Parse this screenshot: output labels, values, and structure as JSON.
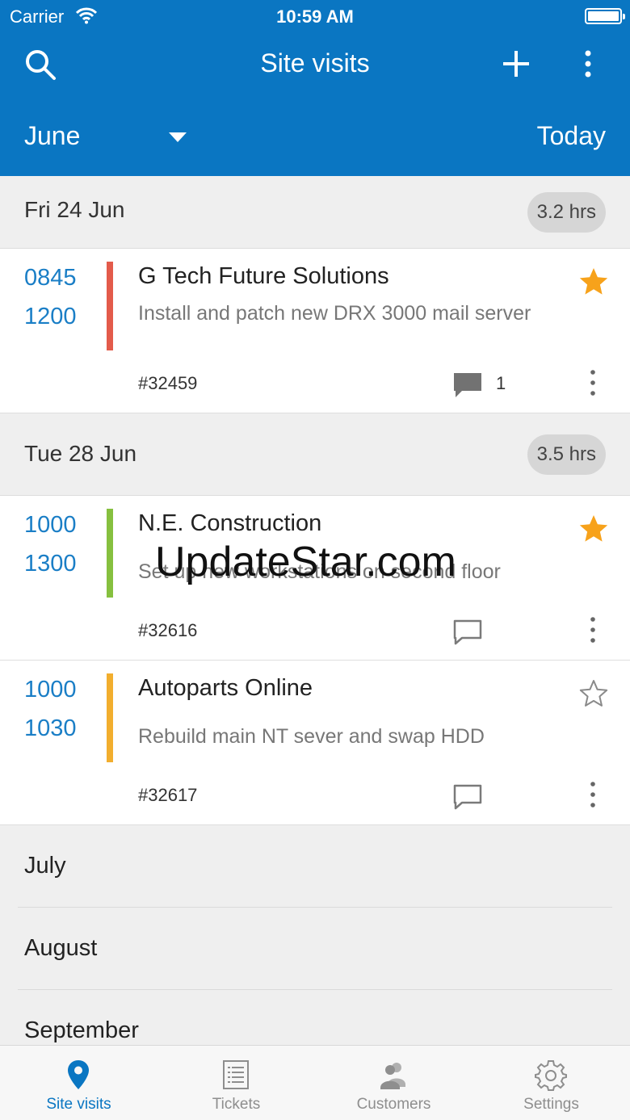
{
  "status_bar": {
    "carrier": "Carrier",
    "time": "10:59 AM"
  },
  "header": {
    "title": "Site visits",
    "month": "June",
    "today_label": "Today",
    "background_color": "#0a76c2"
  },
  "groups": [
    {
      "date": "Fri 24 Jun",
      "hours": "3.2 hrs",
      "visits": [
        {
          "start": "0845",
          "end": "1200",
          "customer": "G Tech Future Solutions",
          "description": "Install and patch new DRX 3000 mail server",
          "ticket": "#32459",
          "comment_count": "1",
          "starred": true,
          "bar_color": "#e35b4b"
        }
      ]
    },
    {
      "date": "Tue 28 Jun",
      "hours": "3.5 hrs",
      "visits": [
        {
          "start": "1000",
          "end": "1300",
          "customer": "N.E. Construction",
          "description": "Set up new workstations on second floor",
          "ticket": "#32616",
          "comment_count": "",
          "starred": true,
          "bar_color": "#86c03f"
        },
        {
          "start": "1000",
          "end": "1030",
          "customer": "Autoparts Online",
          "description": "Rebuild main NT sever and swap HDD",
          "ticket": "#32617",
          "comment_count": "",
          "starred": false,
          "bar_color": "#f2ae2e"
        }
      ]
    }
  ],
  "months": [
    "July",
    "August",
    "September"
  ],
  "watermark": "UpdateStar.com",
  "tabs": [
    {
      "label": "Site visits",
      "icon": "location-pin-icon",
      "active": true
    },
    {
      "label": "Tickets",
      "icon": "tickets-icon",
      "active": false
    },
    {
      "label": "Customers",
      "icon": "customers-icon",
      "active": false
    },
    {
      "label": "Settings",
      "icon": "gear-icon",
      "active": false
    }
  ],
  "colors": {
    "accent": "#0a76c2",
    "star_filled": "#f7a21b",
    "time_text": "#1a7ec6"
  }
}
